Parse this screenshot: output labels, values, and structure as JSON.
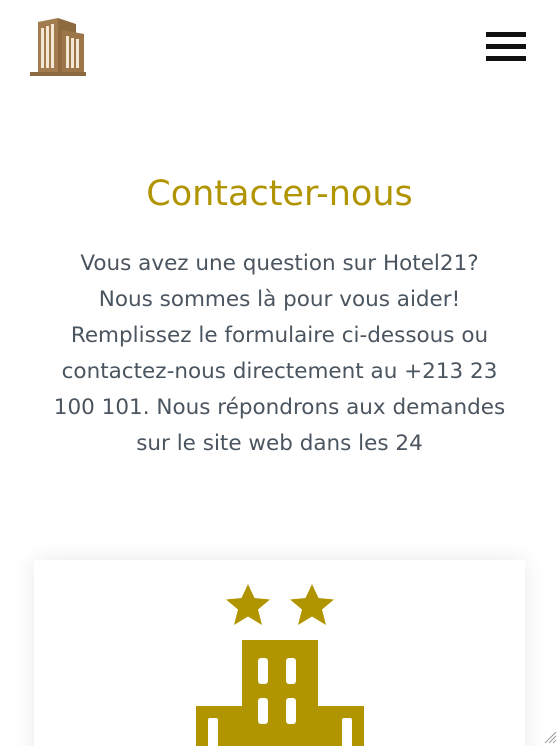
{
  "header": {
    "logo_icon": "hotel-building-logo-icon",
    "menu_icon": "hamburger-menu-icon"
  },
  "contact": {
    "title": "Contacter-nous",
    "description": "Vous avez une question sur Hotel21? Nous sommes là pour vous aider! Remplissez le formulaire ci-dessous ou contactez-nous directement au +213 23 100 101. Nous répondrons aux demandes sur le site web dans les 24"
  },
  "card": {
    "icon": "two-star-hotel-icon"
  },
  "colors": {
    "accent": "#b09400",
    "logo_brown": "#8e6a3f",
    "text": "#4a5560"
  }
}
